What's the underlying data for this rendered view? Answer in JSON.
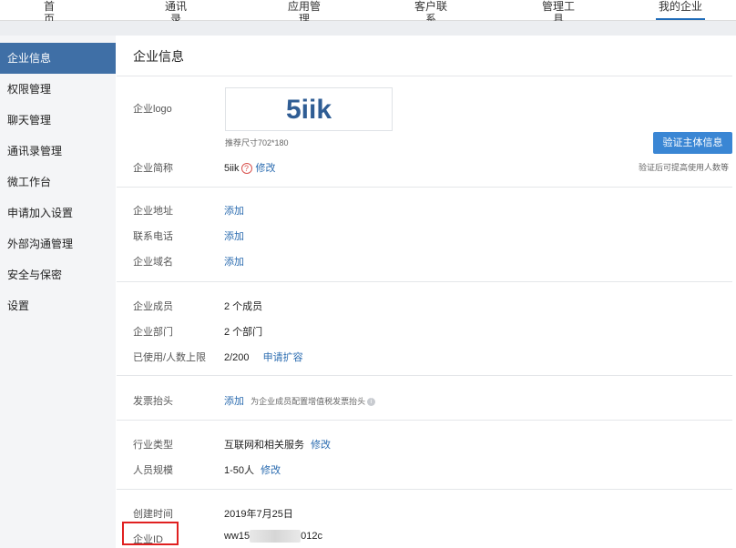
{
  "top_nav": {
    "items": [
      "首页",
      "通讯录",
      "应用管理",
      "客户联系",
      "管理工具",
      "我的企业"
    ],
    "active": "我的企业"
  },
  "sidebar": {
    "items": [
      "企业信息",
      "权限管理",
      "聊天管理",
      "通讯录管理",
      "微工作台",
      "申请加入设置",
      "外部沟通管理",
      "安全与保密",
      "设置"
    ],
    "active": "企业信息"
  },
  "main": {
    "title": "企业信息",
    "logo": {
      "label": "企业logo",
      "text": "5iik",
      "size_hint": "推荐尺寸702*180"
    },
    "verify": {
      "button": "验证主体信息",
      "hint": "验证后可提高使用人数等"
    },
    "short_name": {
      "label": "企业简称",
      "value": "5iik",
      "action": "修改",
      "help_icon": "?"
    },
    "address": {
      "label": "企业地址",
      "action": "添加"
    },
    "phone": {
      "label": "联系电话",
      "action": "添加"
    },
    "domain": {
      "label": "企业域名",
      "action": "添加"
    },
    "members": {
      "label": "企业成员",
      "value": "2 个成员"
    },
    "departments": {
      "label": "企业部门",
      "value": "2 个部门"
    },
    "usage": {
      "label": "已使用/人数上限",
      "value": "2/200",
      "action": "申请扩容"
    },
    "invoice": {
      "label": "发票抬头",
      "action": "添加",
      "hint": "为企业成员配置增值税发票抬头",
      "info_icon": "i"
    },
    "industry": {
      "label": "行业类型",
      "value": "互联网和相关服务",
      "action": "修改"
    },
    "scale": {
      "label": "人员规模",
      "value": "1-50人",
      "action": "修改"
    },
    "created": {
      "label": "创建时间",
      "value": "2019年7月25日"
    },
    "corp_id": {
      "label": "企业ID",
      "value_prefix": "ww15",
      "value_suffix": "012c"
    }
  },
  "colors": {
    "accent": "#3f6fa6",
    "link": "#2b6cb0",
    "button": "#3a86d4",
    "highlight_box": "#e02020"
  }
}
